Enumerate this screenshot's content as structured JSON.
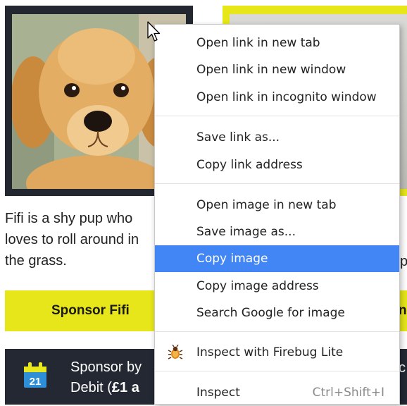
{
  "cards": [
    {
      "image_subject": "golden retriever puppy",
      "description": "Fifi is a shy pup who loves to roll around in the grass.",
      "sponsor_button": "Sponsor Fifi",
      "direct_debit_text": "Sponsor by",
      "direct_debit_text_2": "Debit (",
      "direct_debit_amount": "£1 a",
      "calendar_day": "21"
    },
    {
      "description_fragment": "p",
      "sponsor_button_fragment": "ns",
      "direct_debit_fragment": "c"
    }
  ],
  "context_menu": {
    "items": [
      {
        "label": "Open link in new tab"
      },
      {
        "label": "Open link in new window"
      },
      {
        "label": "Open link in incognito window"
      },
      {
        "label": "Save link as..."
      },
      {
        "label": "Copy link address"
      },
      {
        "label": "Open image in new tab"
      },
      {
        "label": "Save image as..."
      },
      {
        "label": "Copy image",
        "highlighted": true
      },
      {
        "label": "Copy image address"
      },
      {
        "label": "Search Google for image"
      },
      {
        "label": "Inspect with Firebug Lite",
        "icon": "firebug-icon"
      },
      {
        "label": "Inspect",
        "shortcut": "Ctrl+Shift+I"
      }
    ]
  },
  "colors": {
    "accent_yellow": "#e6e61a",
    "dark_panel": "#232832",
    "menu_highlight": "#4285f4",
    "calendar_blue": "#2f8fd6"
  }
}
